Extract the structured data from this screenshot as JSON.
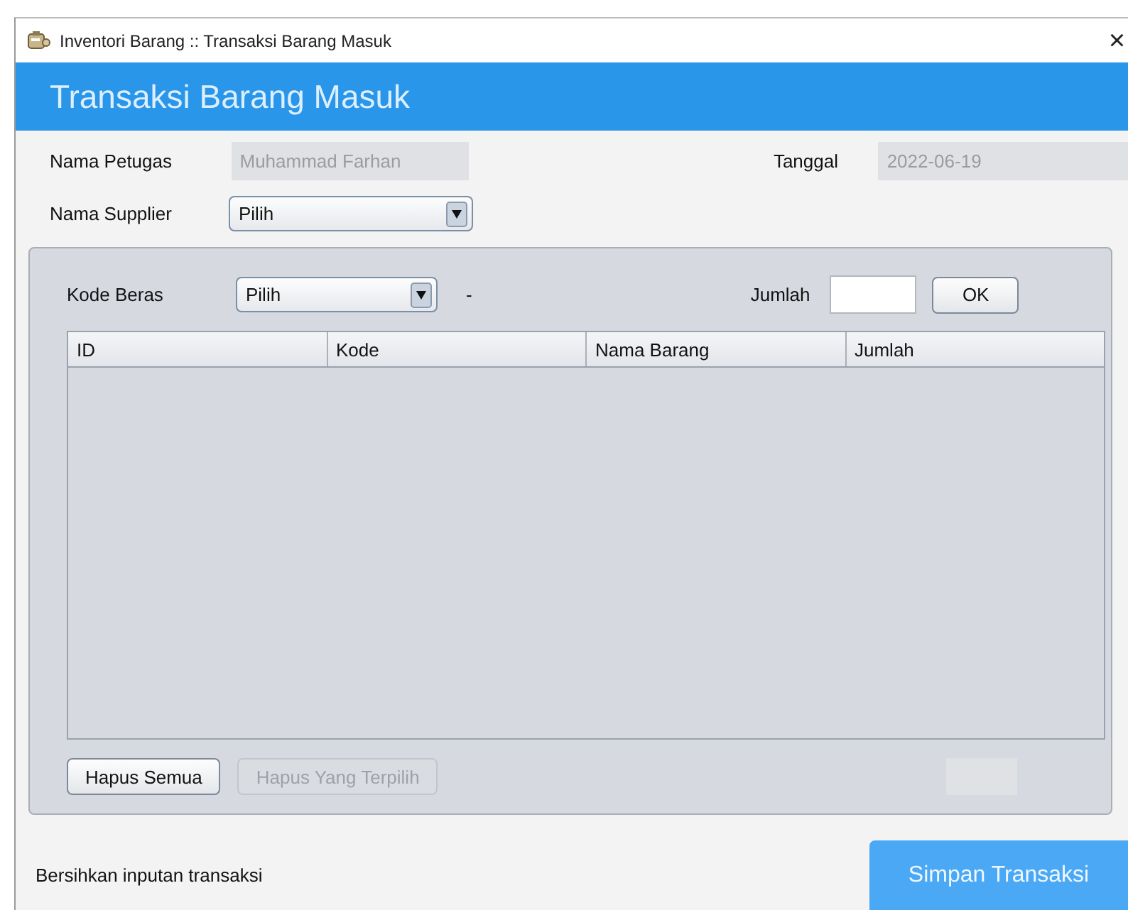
{
  "window": {
    "title": "Inventori Barang :: Transaksi Barang Masuk",
    "close": "×"
  },
  "header": {
    "title": "Transaksi Barang Masuk"
  },
  "fields": [
    {
      "label": "Nama Petugas",
      "value": "Muhammad Farhan",
      "disabled": true
    },
    {
      "label": "Tanggal",
      "value": "2022-06-19",
      "disabled": true
    }
  ],
  "supplier": {
    "label": "Nama Supplier",
    "value": "Pilih"
  },
  "entry": {
    "label": "Kode Beras",
    "value": "Pilih",
    "separator": "-",
    "quantity_label": "Jumlah",
    "ok": "OK"
  },
  "table": {
    "columns": [
      "ID",
      "Kode",
      "Nama Barang",
      "Jumlah"
    ]
  },
  "buttons": [
    {
      "label": "Hapus Semua",
      "disabled": false
    },
    {
      "label": "Hapus Yang Terpilih",
      "disabled": true
    }
  ],
  "footer": {
    "clear_link": "Bersihkan inputan transaksi",
    "save": "Simpan Transaksi"
  }
}
